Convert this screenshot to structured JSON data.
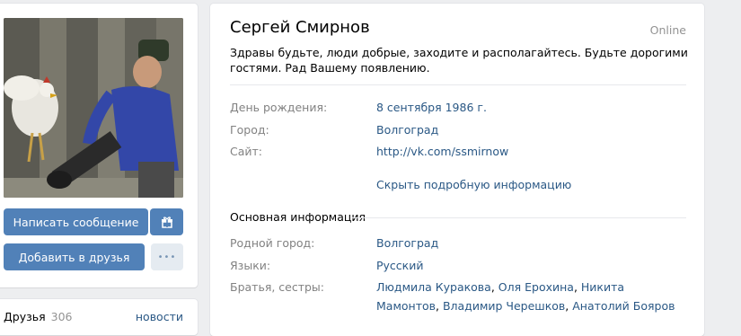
{
  "profile": {
    "name": "Сергей Смирнов",
    "online": "Online",
    "status": "Здравы будьте, люди добрые, заходите и располагайтесь. Будьте дорогими гостями. Рад Вашему появлению."
  },
  "actions": {
    "write_message": "Написать сообщение",
    "add_friend": "Добавить в друзья",
    "more": "•••"
  },
  "friends": {
    "title": "Друзья",
    "count": "306",
    "news": "новости"
  },
  "short_info": [
    {
      "label": "День рождения:",
      "value": "8 сентября 1986 г."
    },
    {
      "label": "Город:",
      "value": "Волгоград"
    },
    {
      "label": "Сайт:",
      "value": "http://vk.com/ssmirnow"
    }
  ],
  "hide_details": "Скрыть подробную информацию",
  "main_info": {
    "title": "Основная информация",
    "rows": [
      {
        "label": "Родной город:",
        "value": "Волгоград"
      },
      {
        "label": "Языки:",
        "value": "Русский"
      },
      {
        "label": "Братья, сестры:"
      }
    ],
    "siblings": [
      "Людмила Куракова",
      "Оля Ерохина",
      "Никита Мамонтов",
      "Владимир Черешков",
      "Анатолий Бояров"
    ]
  }
}
